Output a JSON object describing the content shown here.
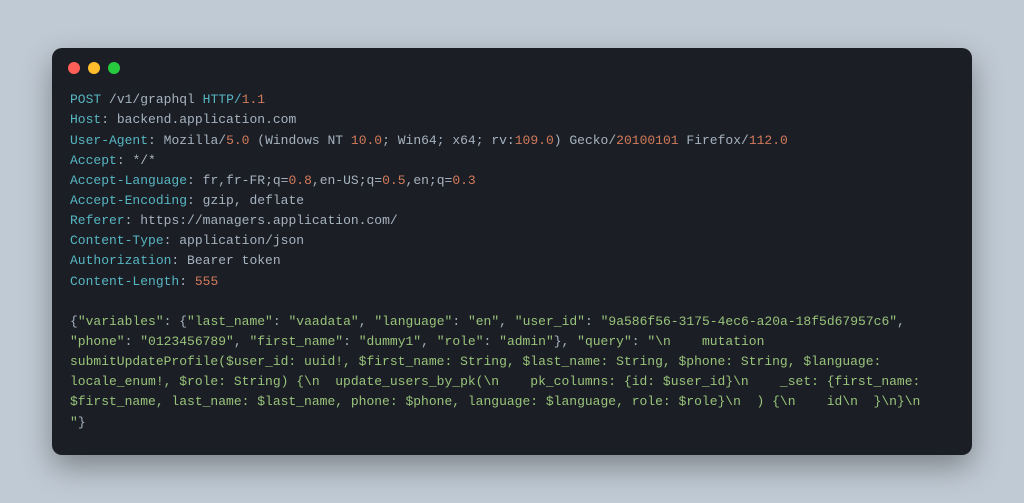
{
  "request": {
    "method": "POST",
    "path": "/v1/graphql",
    "protocol": "HTTP/",
    "version": "1.1"
  },
  "headers": [
    {
      "name": "Host",
      "value": "backend.application.com"
    },
    {
      "name": "User-Agent",
      "prefix": "Mozilla/",
      "v1": "5.0",
      "mid1": " (Windows NT ",
      "v2": "10.0",
      "mid2": "; Win64; x64; rv:",
      "v3": "109.0",
      "mid3": ") Gecko/",
      "v4": "20100101",
      "mid4": " Firefox/",
      "v5": "112.0"
    },
    {
      "name": "Accept",
      "value": "*/*"
    },
    {
      "name": "Accept-Language",
      "p1": "fr,fr-FR;q=",
      "n1": "0.8",
      "p2": ",en-US;q=",
      "n2": "0.5",
      "p3": ",en;q=",
      "n3": "0.3"
    },
    {
      "name": "Accept-Encoding",
      "value": "gzip, deflate"
    },
    {
      "name": "Referer",
      "value": "https://managers.application.com/"
    },
    {
      "name": "Content-Type",
      "value": "application/json"
    },
    {
      "name": "Authorization",
      "value": "Bearer token"
    },
    {
      "name": "Content-Length",
      "num": "555"
    }
  ],
  "body": {
    "s1": "{",
    "k1": "\"variables\"",
    "s2": ": {",
    "k2": "\"last_name\"",
    "s3": ": ",
    "v2": "\"vaadata\"",
    "s4": ", ",
    "k3": "\"language\"",
    "v3": "\"en\"",
    "k4": "\"user_id\"",
    "v4": "\"9a586f56-3175-4ec6-a20a-18f5d67957c6\"",
    "k5": "\"phone\"",
    "v5": "\"0123456789\"",
    "k6": "\"first_name\"",
    "v6": "\"dummy1\"",
    "k7": "\"role\"",
    "v7": "\"admin\"",
    "s5": "}, ",
    "k8": "\"query\"",
    "v8a": "\"\\n    mutation submitUpdateProfile($user_id: uuid!, $first_name: String, $last_name: String, $phone: String, $language: locale_enum!, $role: String) {\\n  update_users_by_pk(\\n    pk_columns: {id: $user_id}\\n    _set: {first_name: $first_name, last_name: $last_name, phone: $phone, language: $language, role: $role}\\n  ) {\\n    id\\n  }\\n}\\n    \"",
    "s6": "}"
  }
}
